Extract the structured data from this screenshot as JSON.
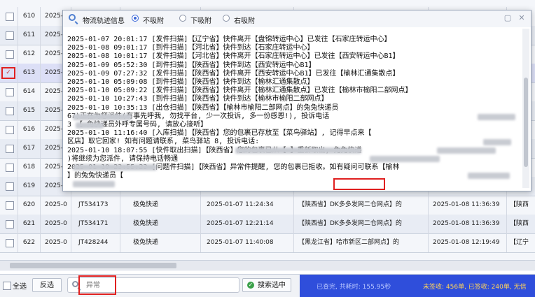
{
  "grid": {
    "rows": [
      {
        "no": "610",
        "year": "2025-0",
        "tracking": "",
        "company": "",
        "time1": "",
        "origin": "",
        "time2": "",
        "origin2": ""
      },
      {
        "no": "611",
        "year": "2025-0",
        "tracking": "",
        "company": "",
        "time1": "",
        "origin": "",
        "time2": "",
        "origin2": ""
      },
      {
        "no": "612",
        "year": "2025-0",
        "tracking": "",
        "company": "",
        "time1": "",
        "origin": "",
        "time2": "",
        "origin2": ""
      },
      {
        "no": "613",
        "year": "2025-0",
        "tracking": "",
        "company": "",
        "time1": "",
        "origin": "",
        "time2": "",
        "origin2": ""
      },
      {
        "no": "614",
        "year": "2025-0",
        "tracking": "",
        "company": "",
        "time1": "",
        "origin": "",
        "time2": "",
        "origin2": ""
      },
      {
        "no": "615",
        "year": "2025-0",
        "tracking": "",
        "company": "",
        "time1": "",
        "origin": "",
        "time2": "",
        "origin2": ""
      },
      {
        "no": "616",
        "year": "2025-0",
        "tracking": "",
        "company": "",
        "time1": "",
        "origin": "",
        "time2": "",
        "origin2": ""
      },
      {
        "no": "617",
        "year": "2025-0",
        "tracking": "",
        "company": "",
        "time1": "",
        "origin": "",
        "time2": "",
        "origin2": ""
      },
      {
        "no": "618",
        "year": "2025-0",
        "tracking": "",
        "company": "",
        "time1": "",
        "origin": "",
        "time2": "",
        "origin2": ""
      },
      {
        "no": "619",
        "year": "2025-0",
        "tracking": "",
        "company": "",
        "time1": "",
        "origin": "",
        "time2": "",
        "origin2": ""
      },
      {
        "no": "620",
        "year": "2025-0",
        "tracking": "JT534173",
        "company": "极兔快递",
        "time1": "2025-01-07 11:24:34",
        "origin": "【陕西省】DK多多发网二仓网点】的",
        "time2": "2025-01-08 11:36:39",
        "origin2": "【陕西"
      },
      {
        "no": "621",
        "year": "2025-0",
        "tracking": "JT534171",
        "company": "极兔快递",
        "time1": "2025-01-07 12:21:14",
        "origin": "【陕西省】DK多多发网二仓网点】的",
        "time2": "2025-01-08 11:36:39",
        "origin2": "【陕西"
      },
      {
        "no": "622",
        "year": "2025-0",
        "tracking": "JT428244",
        "company": "极兔快递",
        "time1": "2025-01-07 11:40:08",
        "origin": "【黑龙江省】哈市新区二部网点】的",
        "time2": "2025-01-08 12:19:49",
        "origin2": "【辽宁"
      }
    ],
    "selected_marker": "✓"
  },
  "popup": {
    "title": "物流轨迹信息",
    "radios": {
      "none": "不吸附",
      "down": "下吸附",
      "right": "右吸附"
    },
    "win_buttons": {
      "min": "▢",
      "close": "✕"
    },
    "log_lines": [
      "2025-01-07 20:01:17      [发件扫描]【辽宁省】快件离开【盘锦转运中心】已发往【石家庄转运中心】",
      "2025-01-08 09:01:17      [到件扫描]【河北省】快件到达【石家庄转运中心】",
      "2025-01-08 10:01:17      [发件扫描]【河北省】快件离开【石家庄转运中心】已发往【西安转运中心B1】",
      "2025-01-09 05:52:30      [到件扫描]【陕西省】快件到达【西安转运中心B1】",
      "2025-01-09 07:27:32      [发件扫描]【陕西省】快件离开【西安转运中心B1】已发往【榆林汇通集散点】",
      "2025-01-10 05:09:08      [到件扫描]【陕西省】快件到达【榆林汇通集散点】",
      "2025-01-10 05:09:22      [发件扫描]【陕西省】快件离开【榆林汇通集散点】已发往【榆林市榆阳二部网点】",
      "2025-01-10 10:27:43      [到件扫描]【陕西省】快件到达【榆林市榆阳二部网点】",
      "2025-01-10 10:35:13      [出仓扫描]【陕西省】【榆林市榆阳二部网点】的兔兔快递员",
      "                67)正在为您派件(有事先呼我, 勿找平台, 少一次投诉, 多一份感恩!), 投诉电话",
      "3     【      免快递员外呼专属号码, 请放心接听】",
      "2025-01-10 11:16:40      [入库扫描]【陕西省】您的包裹已存放至【菜鸟驿站】, 记得早点来【",
      "区店】取它回家! 如有问题请联系, 菜鸟驿站                      8, 投诉电话:",
      "2025-01-10 18:07:55      [快件取出扫描]【陕西省】您的包裹已从【                  】重新取出, 兔兔快递",
      "               )将继续为您派件, 请保持电话畅通",
      "2025-01-10 23:55:23      [问题件扫描]【陕西省】异常件提醒, 您的包裹已拒收。如有疑问可联系【榆林",
      "         】的兔兔快递员【"
    ]
  },
  "toolbar": {
    "select_all": "全选",
    "invert": "反选",
    "search_placeholder": "异常",
    "find_selected": "搜索选中",
    "status_left": "已查完, 共耗时: 155.95秒",
    "status_right": "未签收: 456单, 已签收: 240单, 无信"
  }
}
